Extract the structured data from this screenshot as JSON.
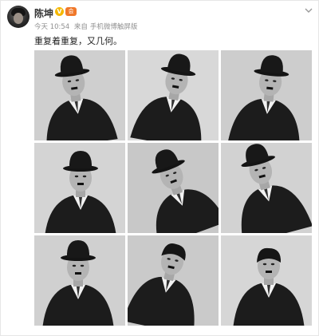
{
  "post": {
    "author_name": "陈坤",
    "verified_badge": "V",
    "member_badge": "会",
    "menu_icon": "chevron-down-icon",
    "meta": {
      "time": "今天 10:54",
      "source_prefix": "来自",
      "source": "手机微博触屏版"
    },
    "text": "重复着重复，又几何。",
    "photos": [
      {
        "alt": "photo-1"
      },
      {
        "alt": "photo-2"
      },
      {
        "alt": "photo-3"
      },
      {
        "alt": "photo-4"
      },
      {
        "alt": "photo-5"
      },
      {
        "alt": "photo-6"
      },
      {
        "alt": "photo-7"
      },
      {
        "alt": "photo-8"
      },
      {
        "alt": "photo-9"
      }
    ]
  },
  "colors": {
    "author": "#333333",
    "meta": "#8f8f8f",
    "verified": "#f5b800",
    "member": "#f0782a",
    "text": "#222222"
  }
}
